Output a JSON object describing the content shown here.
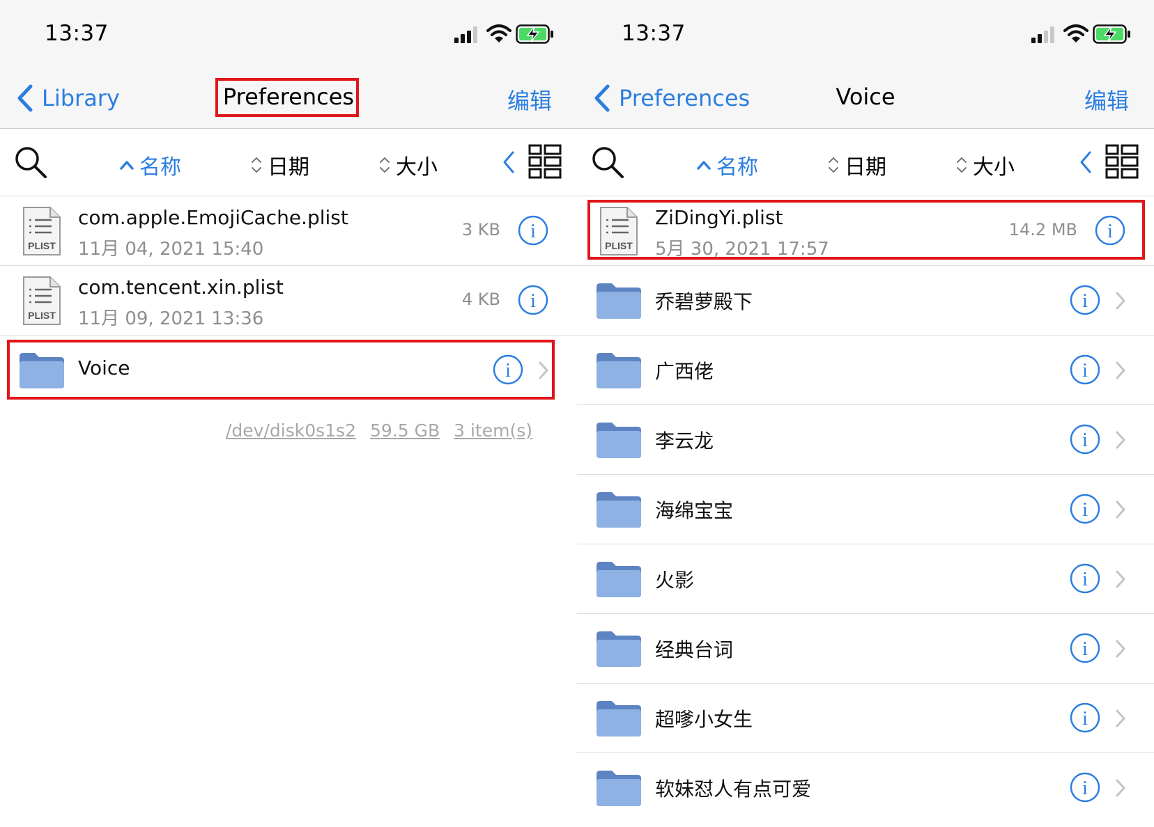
{
  "colors": {
    "accent": "#2b7ee0",
    "highlight": "#e0161b",
    "folder": "#8fb2e5",
    "secondary_text": "#8e8e93"
  },
  "left": {
    "status": {
      "time": "13:37"
    },
    "nav": {
      "back_label": "Library",
      "title": "Preferences",
      "edit_label": "编辑"
    },
    "toolbar": {
      "sort_name": "名称",
      "sort_date": "日期",
      "sort_size": "大小",
      "active_sort": "name"
    },
    "files": [
      {
        "name": "com.apple.EmojiCache.plist",
        "date": "11月 04, 2021 15:40",
        "size": "3 KB",
        "icon": "plist-file-icon",
        "icon_label": "PLIST"
      },
      {
        "name": "com.tencent.xin.plist",
        "date": "11月 09, 2021 13:36",
        "size": "4 KB",
        "icon": "plist-file-icon",
        "icon_label": "PLIST"
      }
    ],
    "folders": [
      {
        "name": "Voice",
        "icon": "folder-icon"
      }
    ],
    "footer": {
      "disk": "/dev/disk0s1s2",
      "capacity": "59.5 GB",
      "items": "3 item(s)"
    }
  },
  "right": {
    "status": {
      "time": "13:37"
    },
    "nav": {
      "back_label": "Preferences",
      "title": "Voice",
      "edit_label": "编辑"
    },
    "toolbar": {
      "sort_name": "名称",
      "sort_date": "日期",
      "sort_size": "大小",
      "active_sort": "name"
    },
    "files": [
      {
        "name": "ZiDingYi.plist",
        "date": "5月 30, 2021 17:57",
        "size": "14.2 MB",
        "icon": "plist-file-icon",
        "icon_label": "PLIST"
      }
    ],
    "folders": [
      {
        "name": "乔碧萝殿下"
      },
      {
        "name": "广西佬"
      },
      {
        "name": "李云龙"
      },
      {
        "name": "海绵宝宝"
      },
      {
        "name": "火影"
      },
      {
        "name": "经典台词"
      },
      {
        "name": "超嗲小女生"
      },
      {
        "name": "软妹怼人有点可爱"
      }
    ]
  }
}
